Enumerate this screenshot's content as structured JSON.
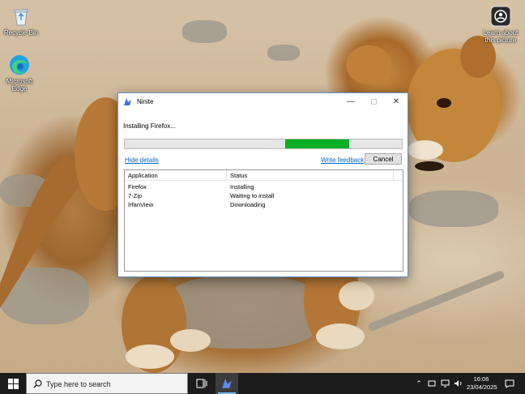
{
  "desktop": {
    "icons": [
      {
        "label": "Recycle Bin",
        "icon": "recycle-bin-icon"
      },
      {
        "label": "Microsoft Edge",
        "icon": "edge-icon"
      },
      {
        "label": "Learn about this picture",
        "icon": "learn-picture-icon"
      }
    ]
  },
  "window": {
    "title": "Ninite",
    "status": "Installing Firefox...",
    "progress_percent": 23,
    "progress_offset_percent": 58,
    "hide_details": "Hide details",
    "write_feedback": "Write feedback",
    "cancel": "Cancel",
    "columns": [
      "Application",
      "Status"
    ],
    "rows": [
      {
        "app": "Firefox",
        "status": "Installing"
      },
      {
        "app": "7-Zip",
        "status": "Waiting to install"
      },
      {
        "app": "IrfanView",
        "status": "Downloading"
      }
    ],
    "controls": [
      "minimize-icon",
      "maximize-icon",
      "close-icon"
    ]
  },
  "taskbar": {
    "search_placeholder": "Type here to search",
    "time": "16:06",
    "date": "23/04/2025",
    "accent_color": "#76b9ed"
  },
  "colors": {
    "progress": "#06b025",
    "link": "#0066cc"
  }
}
